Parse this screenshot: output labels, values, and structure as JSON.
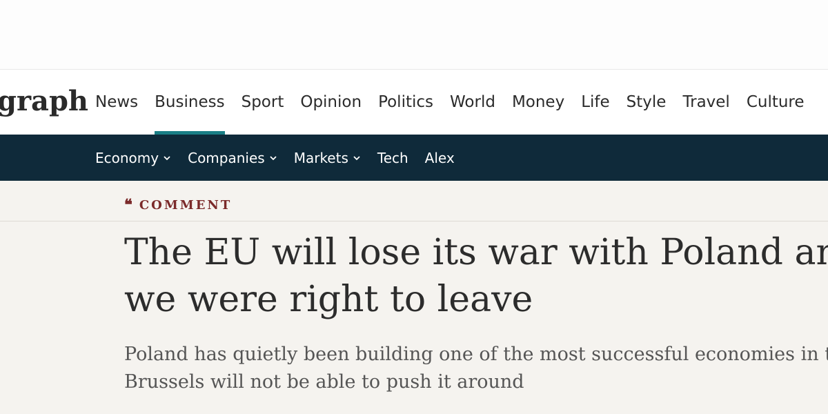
{
  "masthead": {
    "logo_text": "graph"
  },
  "primary_nav": {
    "items": [
      "News",
      "Business",
      "Sport",
      "Opinion",
      "Politics",
      "World",
      "Money",
      "Life",
      "Style",
      "Travel",
      "Culture"
    ],
    "active": "Business"
  },
  "sub_nav": {
    "items": [
      {
        "label": "Economy",
        "has_dropdown": true
      },
      {
        "label": "Companies",
        "has_dropdown": true
      },
      {
        "label": "Markets",
        "has_dropdown": true
      },
      {
        "label": "Tech",
        "has_dropdown": false
      },
      {
        "label": "Alex",
        "has_dropdown": false
      }
    ]
  },
  "article": {
    "kicker": "COMMENT",
    "kicker_icon": "quote-icon",
    "headline_lines": [
      "The EU will lose its war with Poland and",
      "we were right to leave"
    ],
    "standfirst_lines": [
      "Poland has quietly been building one of the most successful economies in th",
      "Brussels will not be able to push it around"
    ]
  },
  "colors": {
    "subnav_bg": "#0f2a3a",
    "active_underline": "#1a7f86",
    "kicker": "#7b2a2a",
    "content_bg": "#f5f3ef"
  }
}
